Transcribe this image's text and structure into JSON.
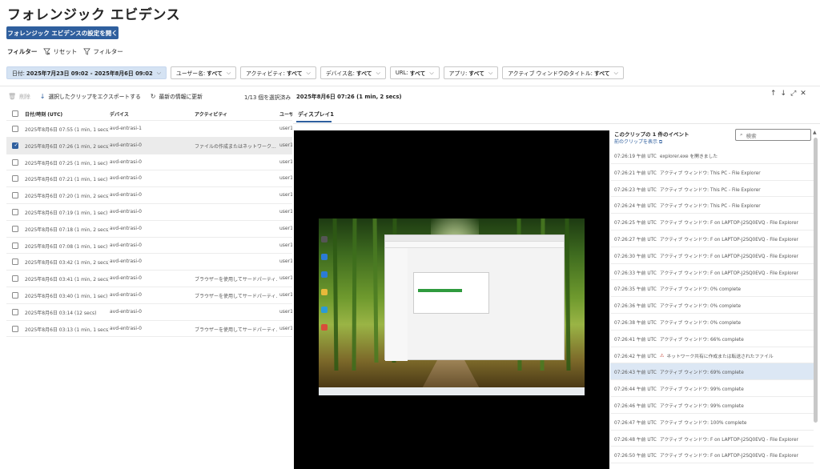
{
  "page": {
    "title": "フォレンジック エビデンス",
    "open_settings_button": "フォレンジック エビデンスの設定を開く"
  },
  "filter_bar": {
    "filter_label": "フィルター",
    "reset_label": "リセット",
    "filter_button": "フィルター"
  },
  "chips": [
    {
      "label": "日付:",
      "value": "2025年7月23日 09:02 - 2025年8月6日 09:02"
    },
    {
      "label": "ユーザー名:",
      "value": "すべて"
    },
    {
      "label": "アクティビティ:",
      "value": "すべて"
    },
    {
      "label": "デバイス名:",
      "value": "すべて"
    },
    {
      "label": "URL:",
      "value": "すべて"
    },
    {
      "label": "アプリ:",
      "value": "すべて"
    },
    {
      "label": "アクティブ ウィンドウのタイトル:",
      "value": "すべて"
    }
  ],
  "toolbar": {
    "delete": "削除",
    "export": "選択したクリップをエクスポートする",
    "refresh": "最新の情報に更新",
    "selected_count": "1/13 個を選択済み"
  },
  "table": {
    "headers": {
      "date": "日付/時刻 (UTC)",
      "device": "デバイス",
      "activity": "アクティビティ",
      "user": "ユーザ"
    },
    "rows": [
      {
        "date": "2025年8月6日 07:55 (1 min, 1 secs)",
        "device": "avd-entrasi-1",
        "activity": "",
        "user": "user1"
      },
      {
        "date": "2025年8月6日 07:26 (1 min, 2 secs)",
        "device": "avd-entrasi-0",
        "activity": "ファイルの作成またはネットワーク...",
        "user": "user1"
      },
      {
        "date": "2025年8月6日 07:25 (1 min, 1 sec)",
        "device": "avd-entrasi-0",
        "activity": "",
        "user": "user1"
      },
      {
        "date": "2025年8月6日 07:21 (1 min, 1 sec)",
        "device": "avd-entrasi-0",
        "activity": "",
        "user": "user1"
      },
      {
        "date": "2025年8月6日 07:20 (1 min, 2 secs)",
        "device": "avd-entrasi-0",
        "activity": "",
        "user": "user1"
      },
      {
        "date": "2025年8月6日 07:19 (1 min, 1 sec)",
        "device": "avd-entrasi-0",
        "activity": "",
        "user": "user1"
      },
      {
        "date": "2025年8月6日 07:18 (1 min, 2 secs)",
        "device": "avd-entrasi-0",
        "activity": "",
        "user": "user1"
      },
      {
        "date": "2025年8月6日 07:08 (1 min, 1 sec)",
        "device": "avd-entrasi-0",
        "activity": "",
        "user": "user1"
      },
      {
        "date": "2025年8月6日 03:42 (1 min, 2 secs)",
        "device": "avd-entrasi-0",
        "activity": "",
        "user": "user1"
      },
      {
        "date": "2025年8月6日 03:41 (1 min, 2 secs)",
        "device": "avd-entrasi-0",
        "activity": "ブラウザーを使用してサードパーティ...",
        "user": "user1"
      },
      {
        "date": "2025年8月6日 03:40 (1 min, 1 sec)",
        "device": "avd-entrasi-0",
        "activity": "ブラウザーを使用してサードパーティ...",
        "user": "user1"
      },
      {
        "date": "2025年8月6日 03:14 (12 secs)",
        "device": "avd-entrasi-0",
        "activity": "",
        "user": "user1"
      },
      {
        "date": "2025年8月6日 03:13 (1 min, 1 secs)",
        "device": "avd-entrasi-0",
        "activity": "ブラウザーを使用してサードパーティ...",
        "user": "user1"
      }
    ]
  },
  "panel": {
    "date": "2025年8月6日 07:26 (1 min, 2 secs)",
    "tab": "ディスプレイ1",
    "events_title": "このクリップの 1 件のイベント",
    "prev_clip_link": "前のクリップを表示 ⧉",
    "search_placeholder": "検索"
  },
  "events": [
    {
      "time": "07:26:19 午前 UTC",
      "desc": "explorer.exe を開きました",
      "warn": false
    },
    {
      "time": "07:26:21 午前 UTC",
      "desc": "アクティブ ウィンドウ: This PC - File Explorer",
      "warn": false
    },
    {
      "time": "07:26:23 午前 UTC",
      "desc": "アクティブ ウィンドウ: This PC - File Explorer",
      "warn": false
    },
    {
      "time": "07:26:24 午前 UTC",
      "desc": "アクティブ ウィンドウ: This PC - File Explorer",
      "warn": false
    },
    {
      "time": "07:26:25 午前 UTC",
      "desc": "アクティブ ウィンドウ: F on LAPTOP-J2SQ0EVQ - File Explorer",
      "warn": false
    },
    {
      "time": "07:26:27 午前 UTC",
      "desc": "アクティブ ウィンドウ: F on LAPTOP-J2SQ0EVQ - File Explorer",
      "warn": false
    },
    {
      "time": "07:26:30 午前 UTC",
      "desc": "アクティブ ウィンドウ: F on LAPTOP-J2SQ0EVQ - File Explorer",
      "warn": false
    },
    {
      "time": "07:26:33 午前 UTC",
      "desc": "アクティブ ウィンドウ: F on LAPTOP-J2SQ0EVQ - File Explorer",
      "warn": false
    },
    {
      "time": "07:26:35 午前 UTC",
      "desc": "アクティブ ウィンドウ: 0% complete",
      "warn": false
    },
    {
      "time": "07:26:36 午前 UTC",
      "desc": "アクティブ ウィンドウ: 0% complete",
      "warn": false
    },
    {
      "time": "07:26:38 午前 UTC",
      "desc": "アクティブ ウィンドウ: 0% complete",
      "warn": false
    },
    {
      "time": "07:26:41 午前 UTC",
      "desc": "アクティブ ウィンドウ: 66% complete",
      "warn": false
    },
    {
      "time": "07:26:42 午前 UTC",
      "desc": "ネットワーク共有に作成または転送されたファイル",
      "warn": true
    },
    {
      "time": "07:26:43 午前 UTC",
      "desc": "アクティブ ウィンドウ: 69% complete",
      "warn": false
    },
    {
      "time": "07:26:44 午前 UTC",
      "desc": "アクティブ ウィンドウ: 99% complete",
      "warn": false
    },
    {
      "time": "07:26:46 午前 UTC",
      "desc": "アクティブ ウィンドウ: 99% complete",
      "warn": false
    },
    {
      "time": "07:26:47 午前 UTC",
      "desc": "アクティブ ウィンドウ: 100% complete",
      "warn": false
    },
    {
      "time": "07:26:48 午前 UTC",
      "desc": "アクティブ ウィンドウ: F on LAPTOP-J2SQ0EVQ - File Explorer",
      "warn": false
    },
    {
      "time": "07:26:50 午前 UTC",
      "desc": "アクティブ ウィンドウ: F on LAPTOP-J2SQ0EVQ - File Explorer",
      "warn": false
    }
  ],
  "selected_row_index": 1,
  "selected_event_index": 13,
  "colors": {
    "accent": "#2f5f9e",
    "selected_event": "#dce7f4",
    "warning": "#c0392b"
  }
}
